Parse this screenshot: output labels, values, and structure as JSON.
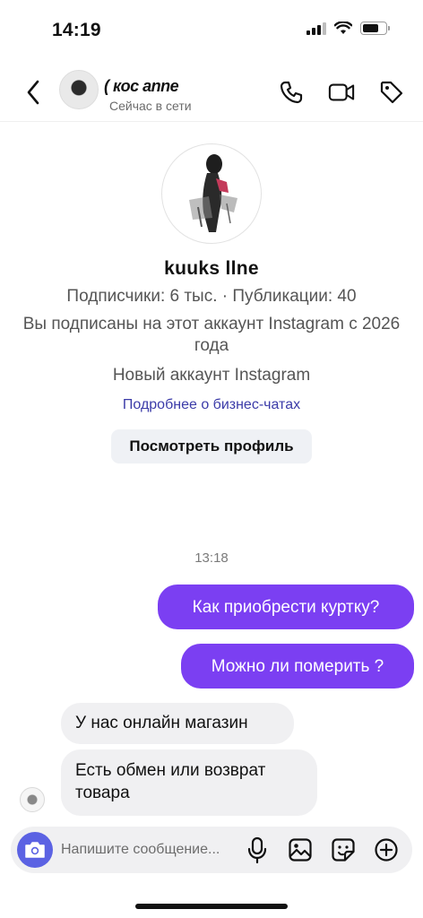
{
  "status_bar": {
    "time": "14:19"
  },
  "header": {
    "name": "( кос anne",
    "status": "Сейчас в сети",
    "icons": [
      "back-icon",
      "phone-icon",
      "video-icon",
      "tag-icon"
    ]
  },
  "profile": {
    "name": "kuuks llne",
    "stats": "Подписчики: 6 тыс. · Публикации: 40",
    "follow_info": "Вы подписаны на этот аккаунт Instagram с 2026 года",
    "new_account": "Новый аккаунт Instagram",
    "business_link": "Подробнее о бизнес-чатах",
    "view_profile_button": "Посмотреть профиль"
  },
  "chat": {
    "timestamp": "13:18",
    "messages": [
      {
        "direction": "outgoing",
        "text": "Как приобрести куртку?"
      },
      {
        "direction": "outgoing",
        "text": "Можно ли померить ?"
      },
      {
        "direction": "incoming",
        "text": "У нас онлайн магазин"
      },
      {
        "direction": "incoming",
        "text": "Есть обмен или возврат товара"
      }
    ]
  },
  "composer": {
    "placeholder": "Напишите сообщение...",
    "icons": [
      "camera-icon",
      "microphone-icon",
      "gallery-icon",
      "sticker-icon",
      "plus-icon"
    ]
  },
  "colors": {
    "outgoing_bubble": "#7b3ff2",
    "incoming_bubble": "#f0f0f2",
    "camera_button": "#5b62e3",
    "link": "#3b3ba8"
  }
}
